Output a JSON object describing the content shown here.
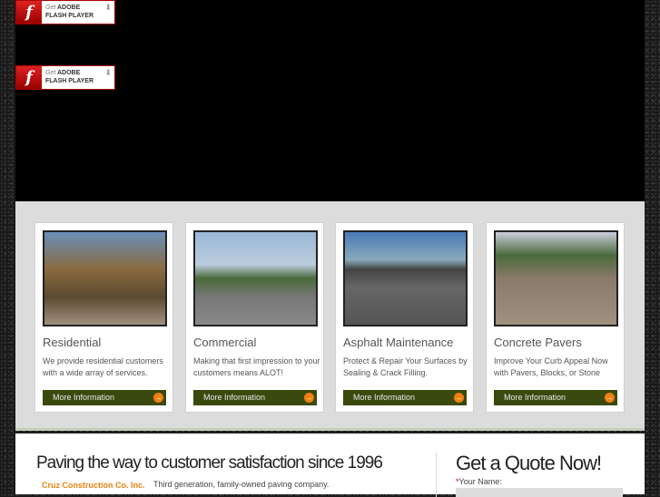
{
  "flash": {
    "get": "Get",
    "adobe": "ADOBE",
    "player": "FLASH PLAYER"
  },
  "cards": [
    {
      "title": "Residential",
      "desc": "We provide residential customers with a wide array of services.",
      "button": "More Information"
    },
    {
      "title": "Commercial",
      "desc": "Making that first impression to your customers means ALOT!",
      "button": "More Information"
    },
    {
      "title": "Asphalt Maintenance",
      "desc": "Protect & Repair Your Surfaces by Sealing & Crack Filling.",
      "button": "More Information"
    },
    {
      "title": "Concrete Pavers",
      "desc": "Improve Your Curb Appeal Now with Pavers, Blocks, or Stone",
      "button": "More Information"
    }
  ],
  "main": {
    "tagline": "Paving the way to customer satisfaction since 1996",
    "company": "Cruz Construction Co. Inc.",
    "company_desc": "Third generation, family-owned paving company."
  },
  "quote": {
    "title": "Get a Quote Now!",
    "required": "*",
    "name_label": "Your Name:"
  }
}
